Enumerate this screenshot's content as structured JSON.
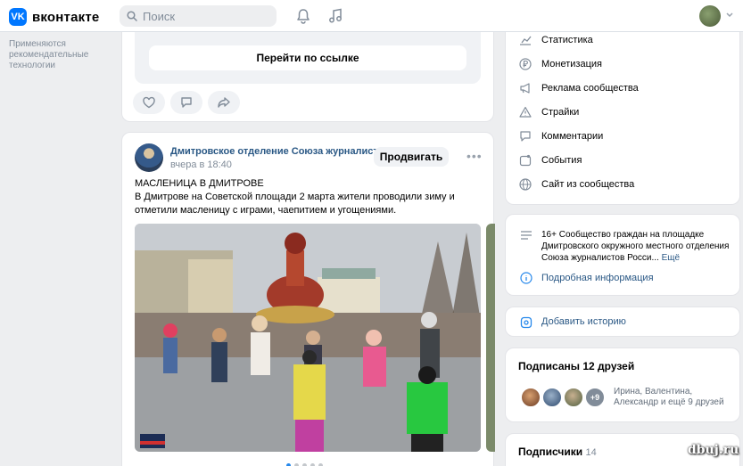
{
  "header": {
    "logo_text": "вконтакте",
    "logo_glyph": "VK",
    "search_placeholder": "Поиск",
    "icons": [
      "search-icon",
      "bell-icon",
      "music-icon",
      "chevron-down-icon"
    ]
  },
  "left_note": "Применяются рекомендательные технологии",
  "post1": {
    "link_button": "Перейти по ссылке",
    "actions": [
      "like-icon",
      "comment-icon",
      "share-icon"
    ]
  },
  "post2": {
    "author": "Дмитровское отделение Союза журналистов...",
    "time": "вчера в 18:40",
    "promote_label": "Продвигать",
    "more_label": "•••",
    "title": "МАСЛЕНИЦА В ДМИТРОВЕ",
    "body": "В Дмитрове на Советской площади 2 марта жители проводили зиму и отметили масленицу с играми, чаепитием и угощениями.",
    "pager_count": 5,
    "pager_active": 0
  },
  "community_menu": {
    "items": [
      {
        "label": "Статистика",
        "icon": "chart-icon"
      },
      {
        "label": "Монетизация",
        "icon": "ruble-icon"
      },
      {
        "label": "Реклама сообщества",
        "icon": "megaphone-icon"
      },
      {
        "label": "Страйки",
        "icon": "warning-icon"
      },
      {
        "label": "Комментарии",
        "icon": "comment-icon"
      },
      {
        "label": "События",
        "icon": "calendar-icon"
      },
      {
        "label": "Сайт из сообщества",
        "icon": "globe-icon"
      }
    ]
  },
  "about": {
    "text": "16+ Сообщество граждан на площадке Дмитровского окружного местного отделения Союза журналистов Росси...",
    "more": "Ещё",
    "details_link": "Подробная информация"
  },
  "story": {
    "label": "Добавить историю"
  },
  "friends": {
    "title": "Подписаны 12 друзей",
    "more_badge": "+9",
    "names": "Ирина, Валентина, Александр и ещё 9 друзей"
  },
  "subscribers": {
    "title": "Подписчики",
    "count": "14"
  },
  "watermark": "dbuj.ru",
  "colors": {
    "accent": "#0077ff",
    "link": "#2a5885",
    "background": "#edeef0",
    "muted": "#818c99"
  }
}
